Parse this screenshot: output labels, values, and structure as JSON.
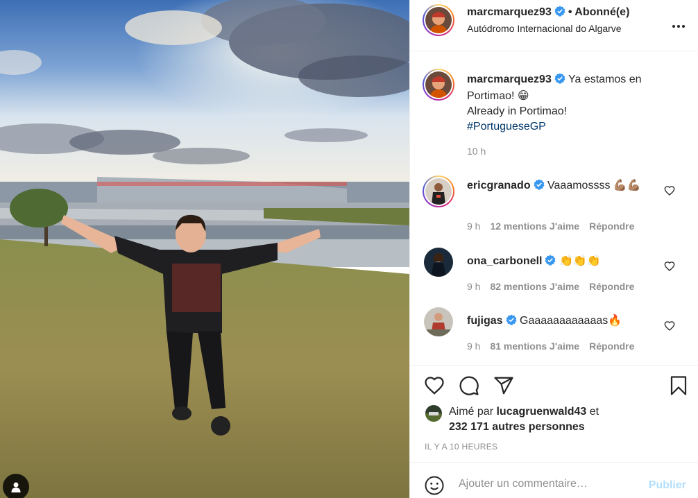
{
  "post": {
    "author": "marcmarquez93",
    "follow_label": "• Abonné(e)",
    "location": "Autódromo Internacional do Algarve",
    "more_icon": "more-horizontal-icon",
    "caption_lines": [
      "Ya estamos en",
      "Portimao! 😁",
      "Already in Portimao!"
    ],
    "hashtag": "#PortugueseGP",
    "caption_time": "10 h"
  },
  "comments": [
    {
      "user": "ericgranado",
      "text": "Vaaamossss 💪🏽💪🏽",
      "time": "9 h",
      "likes": "12 mentions J'aime",
      "reply": "Répondre"
    },
    {
      "user": "ona_carbonell",
      "text": "👏👏👏",
      "time": "9 h",
      "likes": "82 mentions J'aime",
      "reply": "Répondre"
    },
    {
      "user": "fujigas",
      "text": "Gaaaaaaaaaaaas🔥",
      "time": "9 h",
      "likes": "81 mentions J'aime",
      "reply": "Répondre"
    }
  ],
  "likes": {
    "prefix": "Aimé par",
    "user": "lucagruenwald43",
    "suffix": "et",
    "others": "232 171 autres personnes"
  },
  "timestamp": "IL Y A 10 HEURES",
  "add_comment": {
    "placeholder": "Ajouter un commentaire…",
    "publish": "Publier"
  },
  "colors": {
    "verified": "#3897f0",
    "link": "#00376b",
    "muted": "#8e8e8e",
    "publish_disabled": "#b2dffc"
  }
}
